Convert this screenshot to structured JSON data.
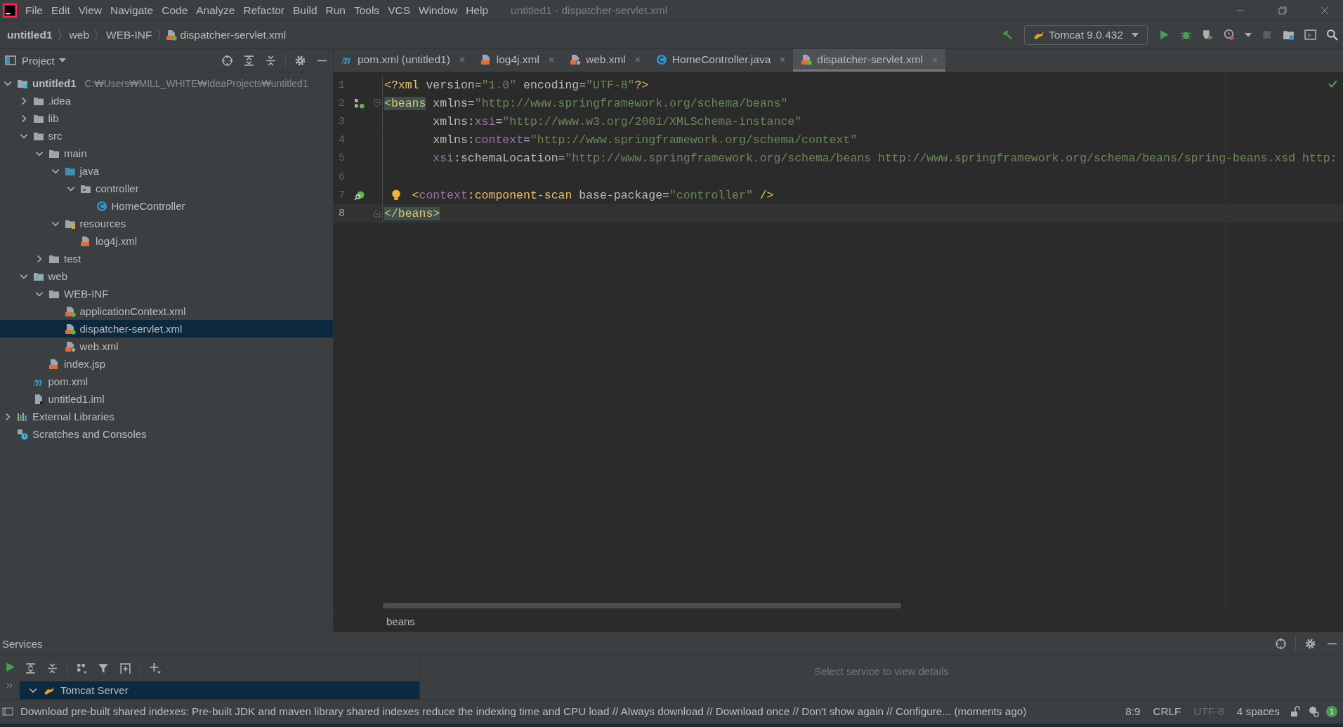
{
  "title_bar": {
    "menu": [
      "File",
      "Edit",
      "View",
      "Navigate",
      "Code",
      "Analyze",
      "Refactor",
      "Build",
      "Run",
      "Tools",
      "VCS",
      "Window",
      "Help"
    ],
    "title": "untitled1 - dispatcher-servlet.xml"
  },
  "nav_bar": {
    "breadcrumbs": [
      {
        "label": "untitled1",
        "kind": "plain"
      },
      {
        "label": "web",
        "kind": "plain"
      },
      {
        "label": "WEB-INF",
        "kind": "plain"
      },
      {
        "label": "dispatcher-servlet.xml",
        "kind": "spring-xml"
      }
    ],
    "run_config": "Tomcat 9.0.432"
  },
  "project_panel": {
    "title": "Project",
    "tree": [
      {
        "label": "untitled1",
        "path": "C:₩Users₩MILL_WHITE₩IdeaProjects₩untitled1",
        "kind": "project",
        "expanded": true,
        "selected": false,
        "children": [
          {
            "label": ".idea",
            "kind": "folder",
            "expanded": false,
            "selected": false
          },
          {
            "label": "lib",
            "kind": "folder",
            "expanded": false,
            "selected": false
          },
          {
            "label": "src",
            "kind": "folder",
            "expanded": true,
            "selected": false,
            "children": [
              {
                "label": "main",
                "kind": "folder",
                "expanded": true,
                "selected": false,
                "children": [
                  {
                    "label": "java",
                    "kind": "source",
                    "expanded": true,
                    "selected": false,
                    "children": [
                      {
                        "label": "controller",
                        "kind": "package",
                        "expanded": true,
                        "selected": false,
                        "children": [
                          {
                            "label": "HomeController",
                            "kind": "class",
                            "selected": false
                          }
                        ]
                      }
                    ]
                  },
                  {
                    "label": "resources",
                    "kind": "resources",
                    "expanded": true,
                    "selected": false,
                    "children": [
                      {
                        "label": "log4j.xml",
                        "kind": "xml",
                        "selected": false
                      }
                    ]
                  }
                ]
              },
              {
                "label": "test",
                "kind": "folder",
                "expanded": false,
                "selected": false
              }
            ]
          },
          {
            "label": "web",
            "kind": "web",
            "expanded": true,
            "selected": false,
            "children": [
              {
                "label": "WEB-INF",
                "kind": "folder",
                "expanded": true,
                "selected": false,
                "children": [
                  {
                    "label": "applicationContext.xml",
                    "kind": "spring-xml",
                    "selected": false
                  },
                  {
                    "label": "dispatcher-servlet.xml",
                    "kind": "spring-xml",
                    "selected": true
                  },
                  {
                    "label": "web.xml",
                    "kind": "web-xml",
                    "selected": false
                  }
                ]
              },
              {
                "label": "index.jsp",
                "kind": "jsp",
                "selected": false
              }
            ]
          },
          {
            "label": "pom.xml",
            "kind": "maven",
            "selected": false
          },
          {
            "label": "untitled1.iml",
            "kind": "iml",
            "selected": false
          }
        ]
      },
      {
        "label": "External Libraries",
        "kind": "libraries",
        "expanded": false,
        "selected": false
      },
      {
        "label": "Scratches and Consoles",
        "kind": "scratches",
        "selected": false
      }
    ]
  },
  "editor": {
    "tabs": [
      {
        "label": "pom.xml (untitled1)",
        "kind": "maven",
        "selected": false
      },
      {
        "label": "log4j.xml",
        "kind": "xml",
        "selected": false
      },
      {
        "label": "web.xml",
        "kind": "web-xml",
        "selected": false
      },
      {
        "label": "HomeController.java",
        "kind": "class",
        "selected": false
      },
      {
        "label": "dispatcher-servlet.xml",
        "kind": "spring-xml",
        "selected": true
      }
    ],
    "lines": [
      {
        "number": "1",
        "kind": "top",
        "current": false,
        "tokens": [
          {
            "kind": "tag",
            "text": "<?xml"
          },
          {
            "kind": "text",
            "text": " version="
          },
          {
            "kind": "value",
            "text": "\"1.0\""
          },
          {
            "kind": "text",
            "text": " encoding="
          },
          {
            "kind": "value",
            "text": "\"UTF-8\""
          },
          {
            "kind": "tag",
            "text": "?>"
          }
        ]
      },
      {
        "number": "2",
        "kind": "top",
        "current": false,
        "gutter": [
          {
            "kind": "beans"
          },
          {
            "kind": "fold-start"
          }
        ],
        "tokens": [
          {
            "kind": "match",
            "text": "<beans"
          },
          {
            "kind": "text",
            "text": " xmlns="
          },
          {
            "kind": "value",
            "text": "\"http://www.springframework.org/schema/beans\""
          }
        ]
      },
      {
        "number": "3",
        "kind": "attribute",
        "current": false,
        "tokens": [
          {
            "kind": "text",
            "text": "xmlns:"
          },
          {
            "kind": "ns",
            "text": "xsi"
          },
          {
            "kind": "text",
            "text": "="
          },
          {
            "kind": "value",
            "text": "\"http://www.w3.org/2001/XMLSchema-instance\""
          }
        ]
      },
      {
        "number": "4",
        "kind": "attribute",
        "current": false,
        "tokens": [
          {
            "kind": "text",
            "text": "xmlns:"
          },
          {
            "kind": "ns",
            "text": "context"
          },
          {
            "kind": "text",
            "text": "="
          },
          {
            "kind": "value",
            "text": "\"http://www.springframework.org/schema/context\""
          }
        ]
      },
      {
        "number": "5",
        "kind": "attribute",
        "current": false,
        "tokens": [
          {
            "kind": "ns",
            "text": "xsi"
          },
          {
            "kind": "text",
            "text": ":schemaLocation="
          },
          {
            "kind": "value",
            "text": "\"http://www.springframework.org/schema/beans http://www.springframework.org/schema/beans/spring-beans.xsd http:"
          }
        ]
      },
      {
        "number": "6",
        "kind": "top",
        "current": false
      },
      {
        "number": "7",
        "kind": "child",
        "current": false,
        "hint": true,
        "gutter": [
          {
            "kind": "scan"
          }
        ],
        "tokens": [
          {
            "kind": "tag",
            "text": "<"
          },
          {
            "kind": "ns",
            "text": "context"
          },
          {
            "kind": "tag",
            "text": ":component-scan"
          },
          {
            "kind": "text",
            "text": " base-package="
          },
          {
            "kind": "value",
            "text": "\"controller\""
          },
          {
            "kind": "tag",
            "text": " />"
          }
        ]
      },
      {
        "number": "8",
        "kind": "top",
        "current": true,
        "gutter": [
          {
            "kind": "fold-end"
          }
        ],
        "tokens": [
          {
            "kind": "match",
            "text": "</beans>"
          }
        ]
      }
    ],
    "breadcrumb": "beans"
  },
  "services": {
    "title": "Services",
    "tree": [
      {
        "label": "Tomcat Server",
        "expanded": true,
        "selected": true
      }
    ],
    "placeholder": "Select service to view details"
  },
  "status_bar": {
    "message": "Download pre-built shared indexes: Pre-built JDK and maven library shared indexes reduce the indexing time and CPU load // Always download // Download once // Don't show again // Configure... (moments ago)",
    "items": [
      {
        "label": "8:9",
        "disabled": false
      },
      {
        "label": "CRLF",
        "disabled": false
      },
      {
        "label": "UTF-8",
        "disabled": true
      },
      {
        "label": "4 spaces",
        "disabled": false
      }
    ],
    "notifications": "1"
  }
}
